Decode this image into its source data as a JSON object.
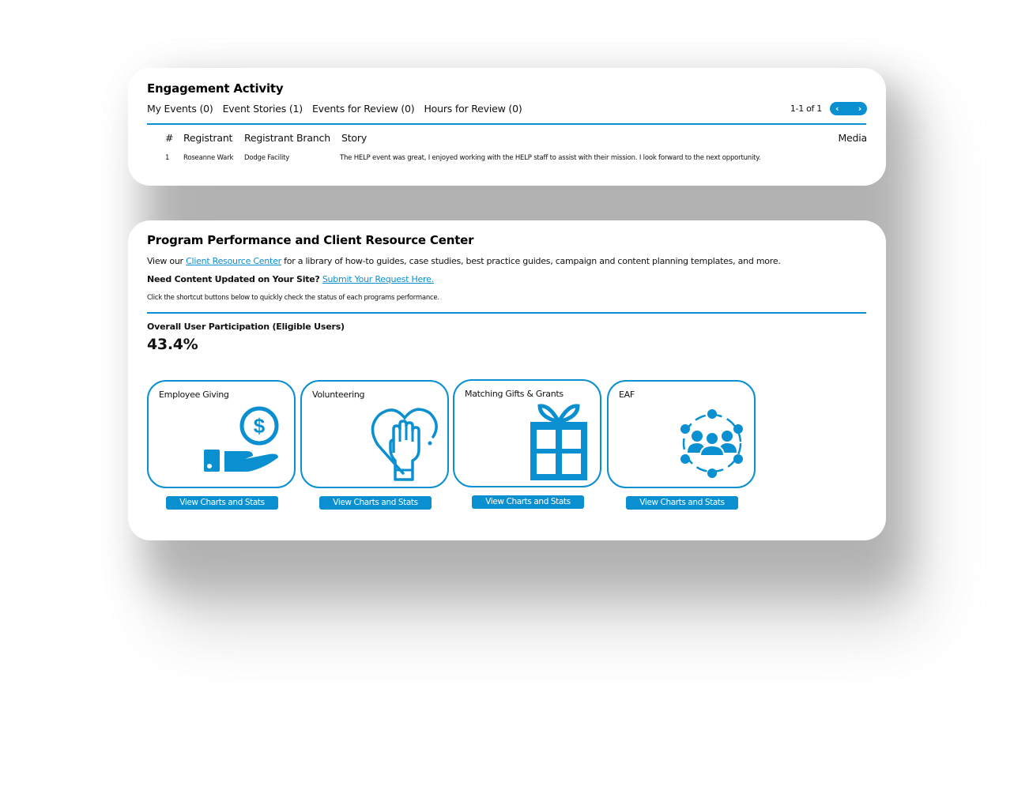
{
  "engagement": {
    "title": "Engagement Activity",
    "tabs": [
      {
        "label": "My Events (0)"
      },
      {
        "label": "Event Stories (1)"
      },
      {
        "label": "Events for Review (0)"
      },
      {
        "label": "Hours for Review (0)"
      }
    ],
    "pagination": {
      "range_text": "1-1 of 1",
      "prev_icon": "‹",
      "next_icon": "›"
    },
    "table": {
      "columns": [
        "#",
        "Registrant",
        "Registrant Branch",
        "Story",
        "Media"
      ],
      "rows": [
        {
          "num": "1",
          "registrant": "Roseanne Wark",
          "branch": "Dodge Facility",
          "story": "The HELP event was great, I enjoyed working with the HELP staff to assist with their mission. I look forward to the next opportunity.",
          "media": ""
        }
      ]
    }
  },
  "program": {
    "title": "Program Performance and Client Resource Center",
    "intro_prefix": "View our ",
    "intro_link": "Client Resource Center",
    "intro_suffix": " for a library of how-to guides, case studies, best practice guides, campaign and content planning templates, and more.",
    "update_bold": "Need Content Updated on Your Site?",
    "update_link": "Submit Your Request Here.",
    "shortcut_note": "Click the shortcut buttons below to quickly check the status of each programs performance.",
    "participation_label": "Overall User Participation (Eligible Users)",
    "participation_value": "43.4%",
    "tiles": [
      {
        "label": "Employee Giving",
        "icon": "hand-coin-icon",
        "button": "View Charts and Stats"
      },
      {
        "label": "Volunteering",
        "icon": "heart-hand-icon",
        "button": "View Charts and Stats"
      },
      {
        "label": "Matching Gifts & Grants",
        "icon": "gift-icon",
        "button": "View Charts and Stats"
      },
      {
        "label": "EAF",
        "icon": "people-network-icon",
        "button": "View Charts and Stats"
      }
    ]
  },
  "colors": {
    "accent": "#0a8fd0",
    "text": "#111111",
    "shadow": "#b0b0b0"
  }
}
